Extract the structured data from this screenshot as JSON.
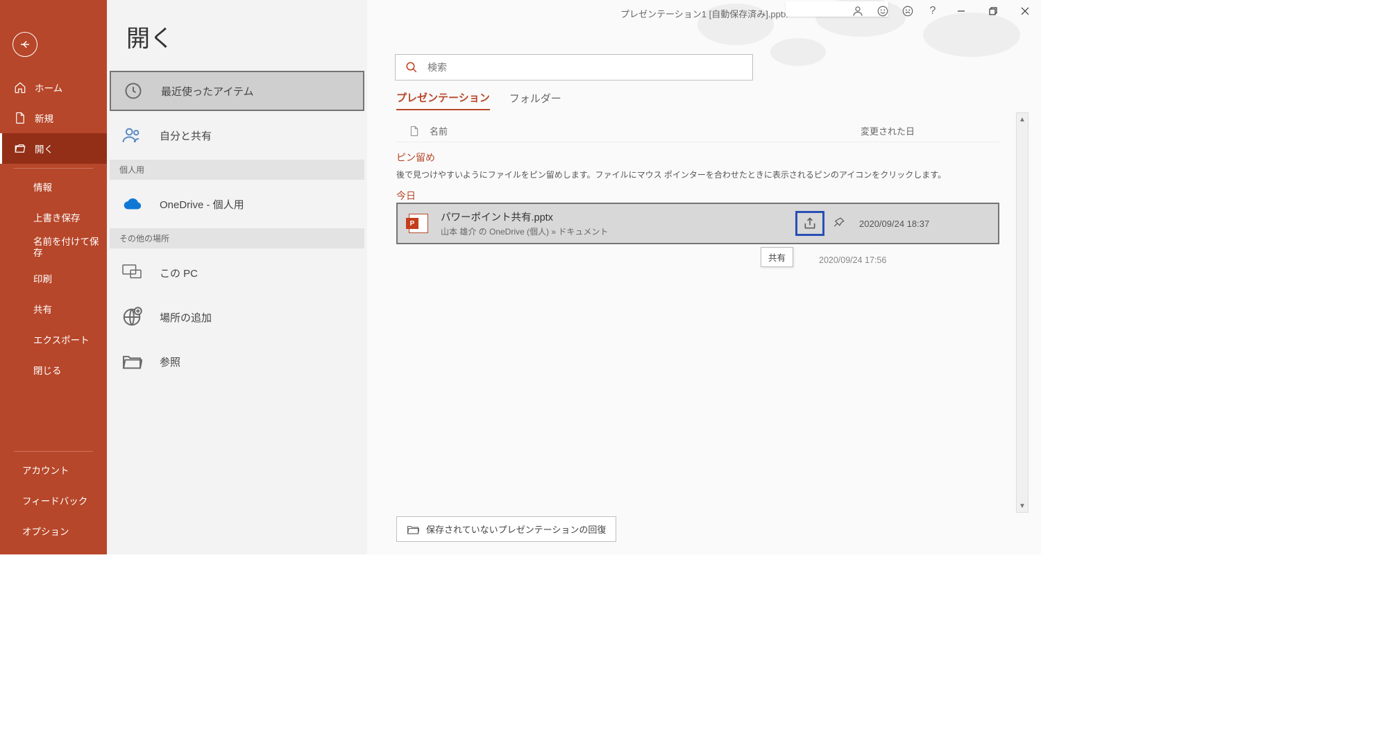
{
  "window_title": "プレゼンテーション1 [自動保存済み].pptx",
  "page_title": "開く",
  "nav": {
    "home": "ホーム",
    "new": "新規",
    "open": "開く",
    "info": "情報",
    "save": "上書き保存",
    "saveas": "名前を付けて保存",
    "print": "印刷",
    "share": "共有",
    "export": "エクスポート",
    "close": "閉じる",
    "account": "アカウント",
    "feedback": "フィードバック",
    "options": "オプション"
  },
  "places": {
    "recent": "最近使ったアイテム",
    "shared": "自分と共有",
    "personal_header": "個人用",
    "onedrive": "OneDrive - 個人用",
    "other_header": "その他の場所",
    "thispc": "この PC",
    "addplace": "場所の追加",
    "browse": "参照"
  },
  "search": {
    "placeholder": "検索"
  },
  "tabs": {
    "presentations": "プレゼンテーション",
    "folders": "フォルダー"
  },
  "columns": {
    "name": "名前",
    "modified": "変更された日"
  },
  "groups": {
    "pinned": "ピン留め",
    "pinned_desc": "後で見つけやすいようにファイルをピン留めします。ファイルにマウス ポインターを合わせたときに表示されるピンのアイコンをクリックします。",
    "today": "今日"
  },
  "file": {
    "name": "パワーポイント共有.pptx",
    "path": "山本 雄介 の OneDrive (個人) » ドキュメント",
    "date": "2020/09/24 18:37"
  },
  "next_file_date": "2020/09/24 17:56",
  "tooltip": "共有",
  "recover": "保存されていないプレゼンテーションの回復"
}
